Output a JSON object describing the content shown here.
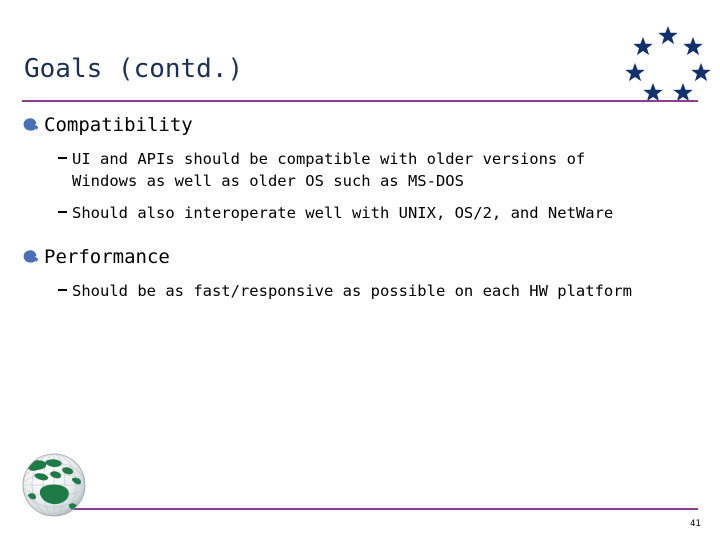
{
  "slide": {
    "title": "Goals (contd.)",
    "page_number": "41",
    "colors": {
      "title_text": "#1B3058",
      "rule": "#8E3D8E",
      "bullet_arrow": "#4A6FB5",
      "star": "#13316B",
      "body_text": "#000000",
      "globe_land": "#1E7A47",
      "background": "#FFFFFF"
    },
    "emblem": {
      "name": "seven-stars-circle",
      "star_count": 7
    },
    "globe": {
      "name": "globe-graphic",
      "region": "Australia and Asia"
    }
  },
  "content": {
    "sections": [
      {
        "heading": "Compatibility",
        "bullet_icon": "arrow-bullet-icon",
        "points": [
          {
            "lines": [
              "UI and APIs should be compatible with older versions of",
              "Windows as well as older OS such as MS-DOS"
            ]
          },
          {
            "lines": [
              "Should also interoperate well with UNIX, OS/2, and NetWare"
            ]
          }
        ]
      },
      {
        "heading": "Performance",
        "bullet_icon": "arrow-bullet-icon",
        "points": [
          {
            "lines": [
              "Should be as fast/responsive as possible on each HW platform"
            ]
          }
        ]
      }
    ]
  }
}
